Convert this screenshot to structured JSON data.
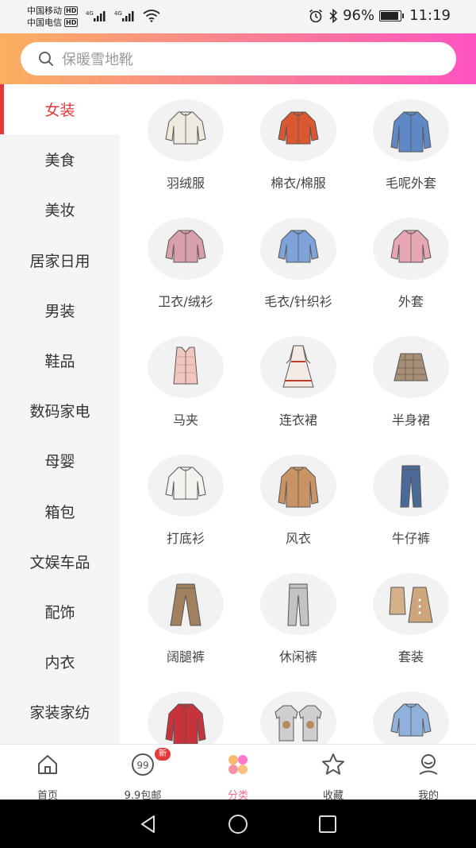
{
  "status": {
    "carrier1": "中国移动",
    "carrier2": "中国电信",
    "hd": "HD",
    "network": "4G",
    "battery_percent": "96%",
    "battery_level": 0.96,
    "time": "11:19"
  },
  "search": {
    "placeholder": "保暖雪地靴"
  },
  "sidebar": {
    "items": [
      {
        "label": "女装",
        "active": true
      },
      {
        "label": "美食"
      },
      {
        "label": "美妆"
      },
      {
        "label": "居家日用"
      },
      {
        "label": "男装"
      },
      {
        "label": "鞋品"
      },
      {
        "label": "数码家电"
      },
      {
        "label": "母婴"
      },
      {
        "label": "箱包"
      },
      {
        "label": "文娱车品"
      },
      {
        "label": "配饰"
      },
      {
        "label": "内衣"
      },
      {
        "label": "家装家纺"
      }
    ]
  },
  "grid": {
    "items": [
      {
        "label": "羽绒服",
        "icon": "down-jacket-icon",
        "color": "#efe9df"
      },
      {
        "label": "棉衣/棉服",
        "icon": "padded-jacket-icon",
        "color": "#d9582f"
      },
      {
        "label": "毛呢外套",
        "icon": "wool-coat-icon",
        "color": "#5f88c6"
      },
      {
        "label": "卫衣/绒衫",
        "icon": "sweatshirt-icon",
        "color": "#d9a0ab"
      },
      {
        "label": "毛衣/针织衫",
        "icon": "sweater-icon",
        "color": "#7ea3d8"
      },
      {
        "label": "外套",
        "icon": "leather-jacket-icon",
        "color": "#e6a6b2"
      },
      {
        "label": "马夹",
        "icon": "vest-icon",
        "color": "#f0c6bf"
      },
      {
        "label": "连衣裙",
        "icon": "dress-icon",
        "color": "#f3ebe3"
      },
      {
        "label": "半身裙",
        "icon": "skirt-icon",
        "color": "#a58f79"
      },
      {
        "label": "打底衫",
        "icon": "base-top-icon",
        "color": "#f4f2ee"
      },
      {
        "label": "风衣",
        "icon": "trench-coat-icon",
        "color": "#c99363"
      },
      {
        "label": "牛仔裤",
        "icon": "jeans-icon",
        "color": "#4b6a98"
      },
      {
        "label": "阔腿裤",
        "icon": "wide-pants-icon",
        "color": "#a1805f"
      },
      {
        "label": "休闲裤",
        "icon": "casual-pants-icon",
        "color": "#c3c3c5"
      },
      {
        "label": "套装",
        "icon": "suit-set-icon",
        "color": "#d4b089"
      },
      {
        "label": "",
        "icon": "red-coat-icon",
        "color": "#c8323a"
      },
      {
        "label": "",
        "icon": "couple-hoodie-icon",
        "color": "#cfcfcf"
      },
      {
        "label": "",
        "icon": "blouse-icon",
        "color": "#8fb1dc"
      }
    ]
  },
  "bottomnav": {
    "items": [
      {
        "label": "首页",
        "icon": "home-icon"
      },
      {
        "label": "9.9包邮",
        "icon": "free-shipping-icon",
        "badge": "新"
      },
      {
        "label": "分类",
        "icon": "category-icon",
        "active": true
      },
      {
        "label": "收藏",
        "icon": "star-icon"
      },
      {
        "label": "我的",
        "icon": "profile-icon"
      }
    ]
  },
  "colors": {
    "accent": "#e4393c",
    "nav_active": "#f26b86",
    "header_gradient_start": "#fbb060",
    "header_gradient_end": "#ff54c0"
  }
}
